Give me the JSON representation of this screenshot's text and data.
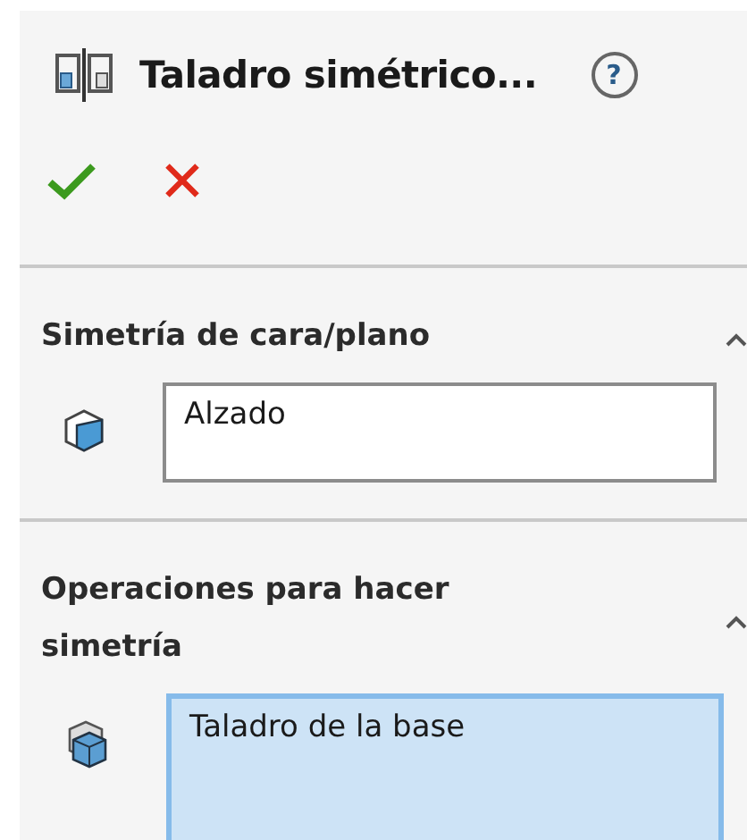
{
  "panel": {
    "title": "Taladro simétrico...",
    "help": "?",
    "actions": [
      {
        "kind": "ok"
      },
      {
        "kind": "cancel"
      }
    ]
  },
  "sections": [
    {
      "title": "Simetría de cara/plano",
      "expanded": true,
      "field": {
        "kind": "plane",
        "value": "Alzado",
        "selected": false
      }
    },
    {
      "title": "Operaciones para hacer simetría",
      "expanded": true,
      "field": {
        "kind": "features",
        "value": "Taladro de la base",
        "selected": true
      }
    }
  ]
}
